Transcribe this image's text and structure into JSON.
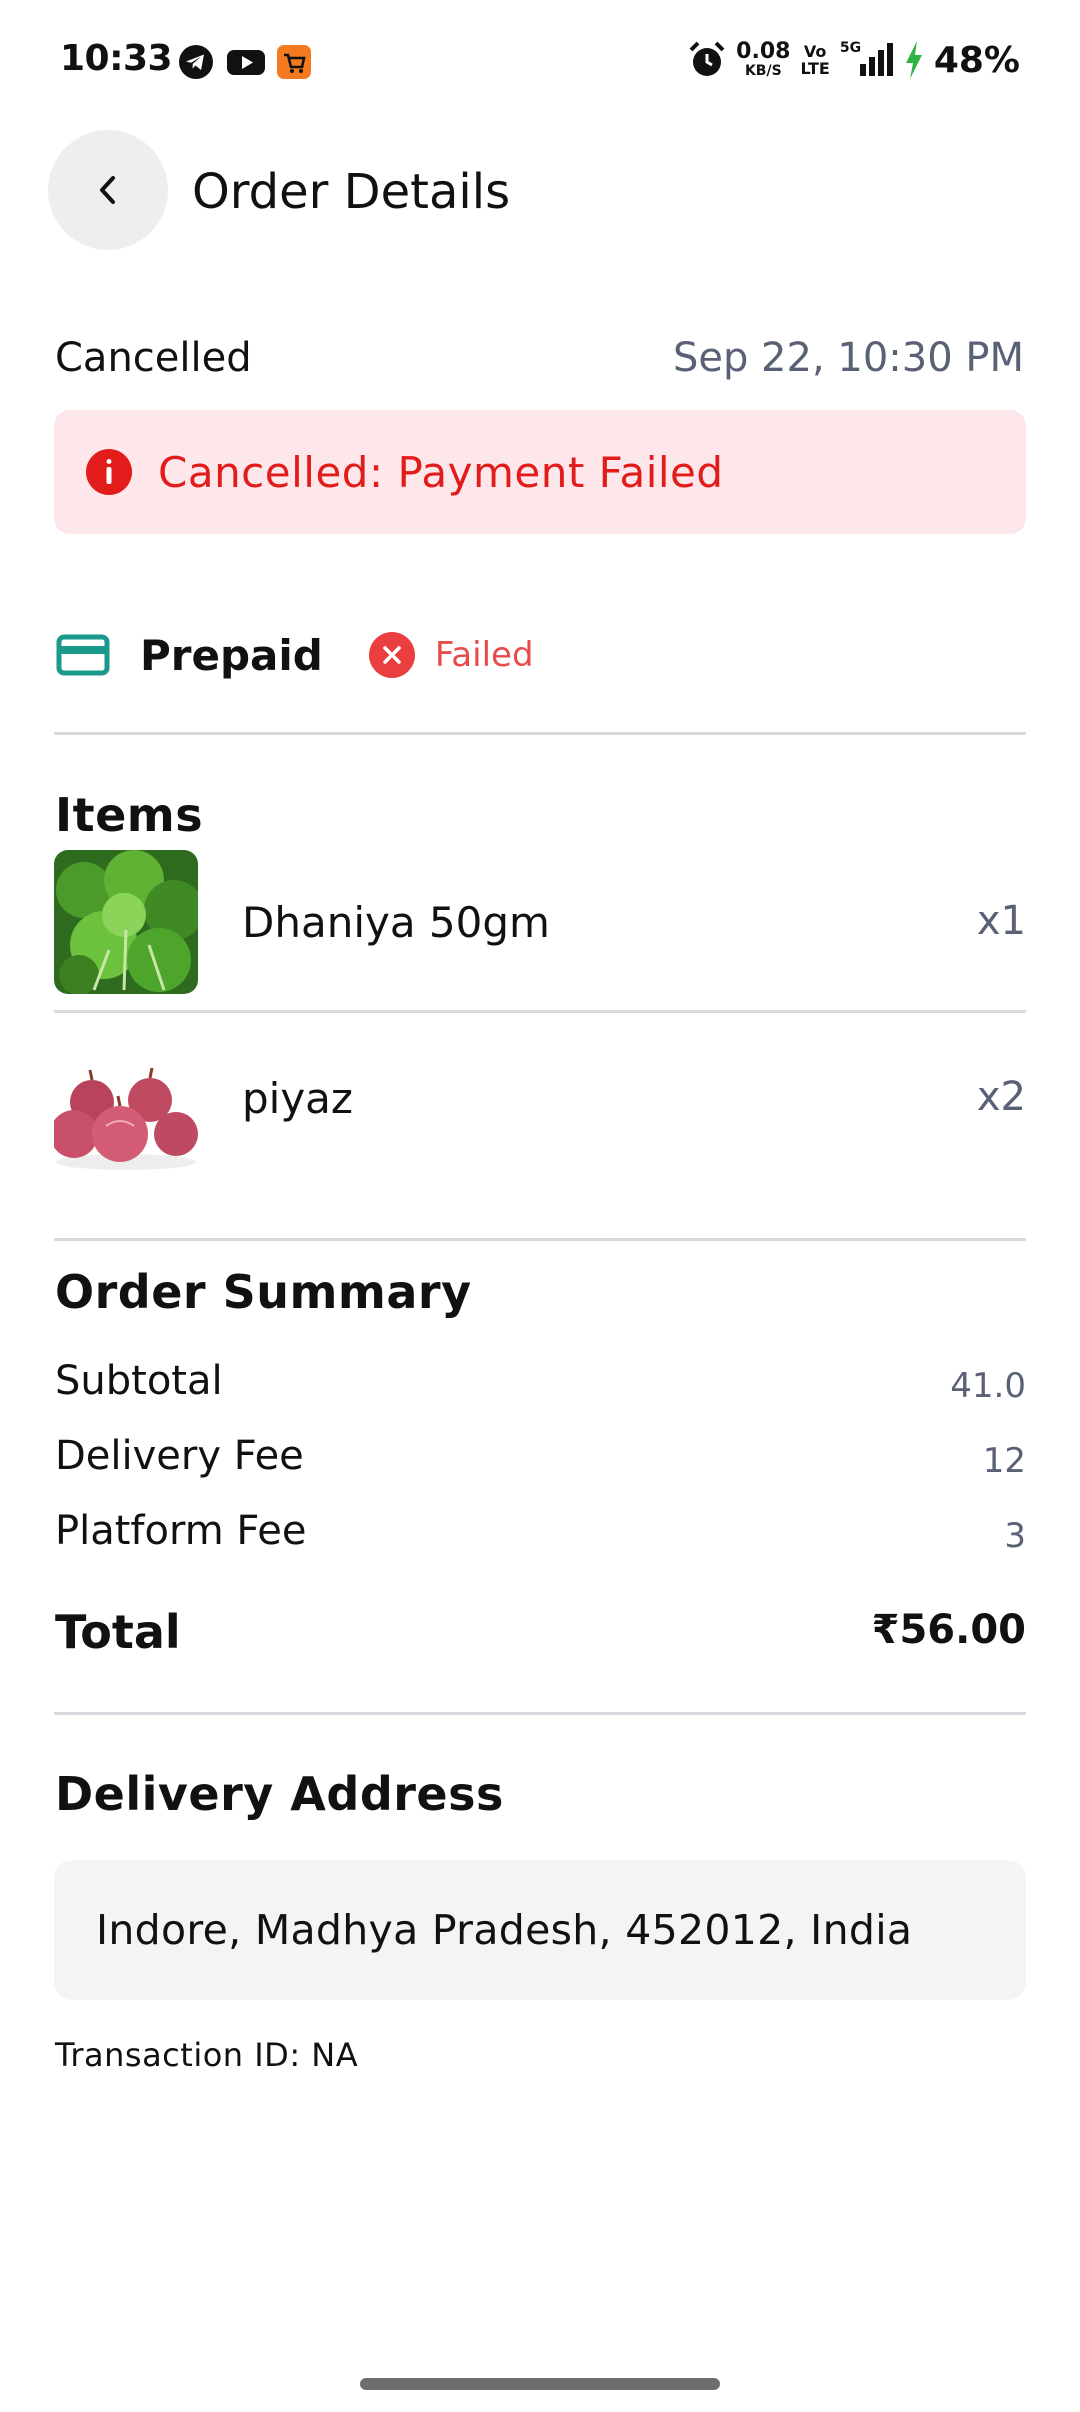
{
  "status_bar": {
    "time": "10:33",
    "network_speed": "0.08",
    "network_unit": "KB/S",
    "volte_top": "Vo",
    "volte_bottom": "LTE",
    "signal": "5G",
    "battery": "48%",
    "app_icons": [
      "telegram-icon",
      "youtube-icon",
      "cart-app-icon"
    ],
    "accent_orange": "#f47a20",
    "charging_color": "#2fb344"
  },
  "header": {
    "title": "Order Details",
    "back_icon": "chevron-left-icon"
  },
  "order": {
    "status": "Cancelled",
    "datetime": "Sep 22, 10:30 PM",
    "alert_text": "Cancelled: Payment Failed",
    "alert_color": "#e21b1b",
    "alert_bg": "#fde7ea"
  },
  "payment": {
    "method": "Prepaid",
    "status": "Failed",
    "card_icon_color": "#1a9a8a"
  },
  "items": {
    "title": "Items",
    "list": [
      {
        "name": "Dhaniya 50gm",
        "qty": "x1",
        "image": "coriander-image"
      },
      {
        "name": "piyaz",
        "qty": "x2",
        "image": "onion-image"
      }
    ]
  },
  "summary": {
    "title": "Order Summary",
    "rows": [
      {
        "label": "Subtotal",
        "value": "41.0"
      },
      {
        "label": "Delivery Fee",
        "value": "12"
      },
      {
        "label": "Platform Fee",
        "value": "3"
      }
    ],
    "total_label": "Total",
    "total_value": "₹56.00"
  },
  "delivery": {
    "title": "Delivery Address",
    "address": "Indore, Madhya Pradesh, 452012, India"
  },
  "transaction": {
    "text": "Transaction ID: NA"
  }
}
